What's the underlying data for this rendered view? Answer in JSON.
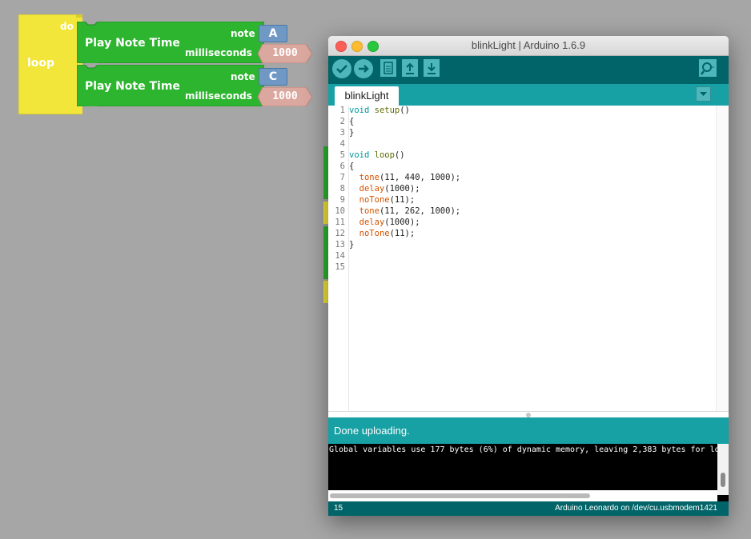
{
  "blockly": {
    "loop_label": "loop",
    "do_label": "do",
    "blocks": [
      {
        "title": "Play Note Time",
        "note_label": "note",
        "note_value": "A",
        "ms_label": "milliseconds",
        "ms_value": "1000"
      },
      {
        "title": "Play Note Time",
        "note_label": "note",
        "note_value": "C",
        "ms_label": "milliseconds",
        "ms_value": "1000"
      }
    ]
  },
  "window": {
    "title": "blinkLight | Arduino 1.6.9",
    "tab": "blinkLight",
    "line_numbers": [
      "1",
      "2",
      "3",
      "4",
      "5",
      "6",
      "7",
      "8",
      "9",
      "10",
      "11",
      "12",
      "13",
      "14",
      "15"
    ],
    "status": "Done uploading.",
    "console": "Global variables use 177 bytes (6%) of dynamic memory, leaving 2,383 bytes for lo",
    "footer_line": "15",
    "footer_board": "Arduino Leonardo on /dev/cu.usbmodem1421"
  },
  "code": {
    "l1a": "void",
    "l1b": " ",
    "l1c": "setup",
    "l1d": "()",
    "l2": "{",
    "l3": "}",
    "l5a": "void",
    "l5b": " ",
    "l5c": "loop",
    "l5d": "()",
    "l6": "{",
    "l7a": "  ",
    "l7b": "tone",
    "l7c": "(11, 440, 1000);",
    "l8a": "  ",
    "l8b": "delay",
    "l8c": "(1000);",
    "l9a": "  ",
    "l9b": "noTone",
    "l9c": "(11);",
    "l10a": "  ",
    "l10b": "tone",
    "l10c": "(11, 262, 1000);",
    "l11a": "  ",
    "l11b": "delay",
    "l11c": "(1000);",
    "l12a": "  ",
    "l12b": "noTone",
    "l12c": "(11);",
    "l13": "}"
  },
  "colors": {
    "desktop": "#a6a6a6",
    "loop_block": "#f2e63a",
    "note_block": "#2db52f",
    "note_chip": "#6f98c4",
    "number_chip": "#dba8a0",
    "toolbar": "#006468",
    "tabbar": "#17a1a5"
  },
  "icons": [
    "verify-icon",
    "upload-arrow-icon",
    "new-file-icon",
    "open-arrow-up-icon",
    "save-arrow-down-icon",
    "serial-monitor-icon",
    "tab-dropdown-icon"
  ]
}
